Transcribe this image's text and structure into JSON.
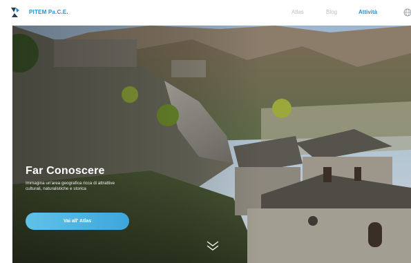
{
  "brand": {
    "name": "PITEM Pa.C.E."
  },
  "nav": {
    "items": [
      {
        "label": "Atlas",
        "active": false
      },
      {
        "label": "Blog",
        "active": false
      },
      {
        "label": "Attività",
        "active": true
      }
    ],
    "language_icon": "globe-icon"
  },
  "hero": {
    "title": "Far Conoscere",
    "description_line1": "Immagina un'area geografica ricca di attrattive",
    "description_line2": "culturali, naturalistiche e storica",
    "cta_label": "Vai all' Atlas",
    "scroll_icon": "double-chevron-down-icon"
  },
  "colors": {
    "accent": "#2a8fc9",
    "nav_inactive": "#b9bec6",
    "cta_start": "#5fc2e8",
    "cta_end": "#3ea6dc"
  }
}
